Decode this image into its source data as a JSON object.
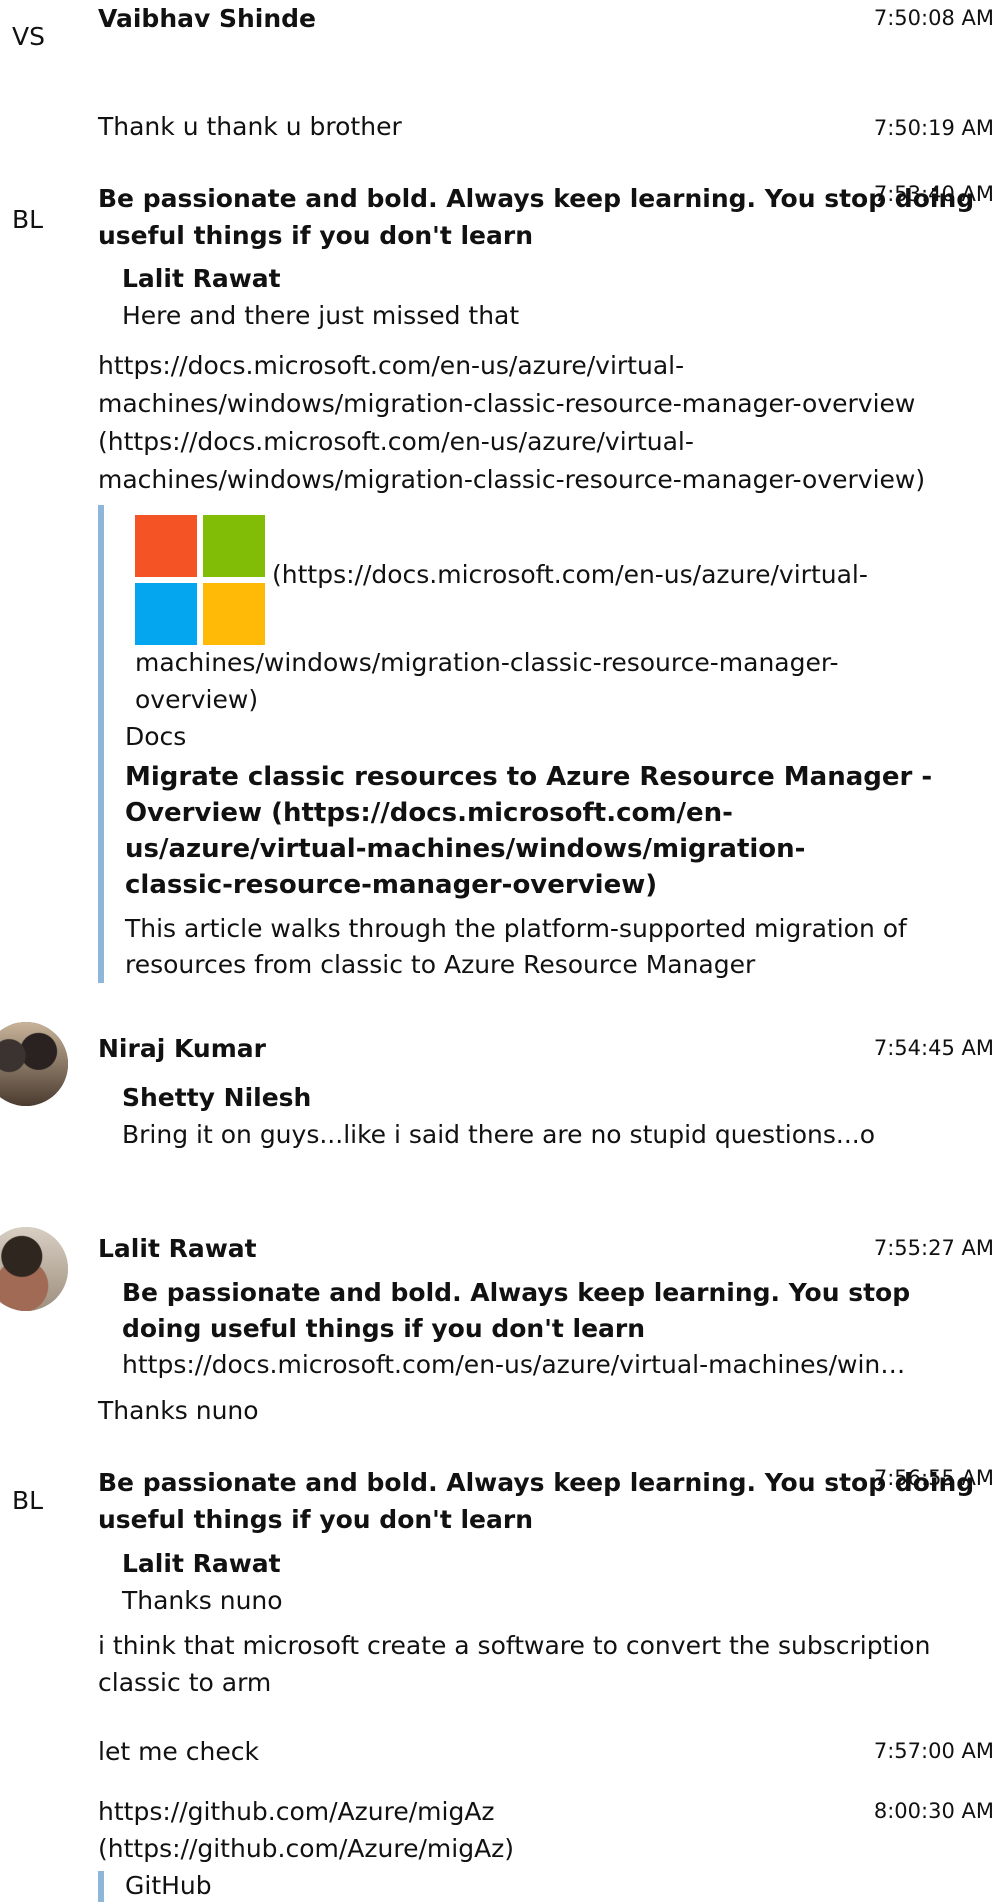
{
  "messages": {
    "m1": {
      "initials": "VS",
      "sender": "Vaibhav Shinde",
      "time": "7:50:08 AM"
    },
    "m2": {
      "text": "Thank u thank u brother",
      "time": "7:50:19 AM"
    },
    "m3": {
      "initials": "BL",
      "sender_line1": "Be passionate and bold. Always keep learning. You stop doing",
      "sender_line2": "useful things if you don't learn",
      "time": "7:53:40 AM",
      "quote_name": "Lalit Rawat",
      "quote_text": "Here and there just missed that",
      "link_lines": [
        "https://docs.microsoft.com/en-us/azure/virtual-",
        "machines/windows/migration-classic-resource-manager-overview",
        "(https://docs.microsoft.com/en-us/azure/virtual-",
        "machines/windows/migration-classic-resource-manager-overview)"
      ],
      "card": {
        "image_link_line1": "(https://docs.microsoft.com/en-us/azure/virtual-",
        "image_link_line2": "machines/windows/migration-classic-resource-manager-",
        "image_link_line3": "overview)",
        "site": "Docs",
        "title_lines": [
          "Migrate classic resources to Azure Resource Manager -",
          "Overview (https://docs.microsoft.com/en-",
          "us/azure/virtual-machines/windows/migration-",
          "classic-resource-manager-overview)"
        ],
        "desc_line1": "This article walks through the platform-supported migration of",
        "desc_line2": "resources from classic to Azure Resource Manager"
      }
    },
    "m4": {
      "sender": "Niraj Kumar",
      "time": "7:54:45 AM",
      "quote_name": "Shetty Nilesh",
      "quote_text": "Bring it on guys...like i said there are no stupid questions...o"
    },
    "m5": {
      "sender": "Lalit Rawat",
      "time": "7:55:27 AM",
      "quote_name_line1": "Be passionate and bold. Always keep learning. You stop",
      "quote_name_line2": "doing useful things if you don't learn",
      "quote_text": "https://docs.microsoft.com/en-us/azure/virtual-machines/win…",
      "text": "Thanks nuno"
    },
    "m6": {
      "initials": "BL",
      "sender_line1": "Be passionate and bold. Always keep learning. You stop doing",
      "sender_line2": "useful things if you don't learn",
      "time": "7:56:55 AM",
      "quote_name": "Lalit Rawat",
      "quote_text": "Thanks nuno",
      "text_line1": "i think that microsoft create a software to convert the subscription",
      "text_line2": "classic to arm"
    },
    "m7": {
      "text": "let me check",
      "time": "7:57:00 AM"
    },
    "m8": {
      "link_line1": "https://github.com/Azure/migAz",
      "link_line2": "(https://github.com/Azure/migAz)",
      "time": "8:00:30 AM",
      "card_site": "GitHub"
    }
  },
  "colors": {
    "card_bar": "#8db6d8",
    "ms_red": "#f35325",
    "ms_green": "#81bc06",
    "ms_blue": "#05a6f0",
    "ms_yellow": "#ffba08"
  }
}
